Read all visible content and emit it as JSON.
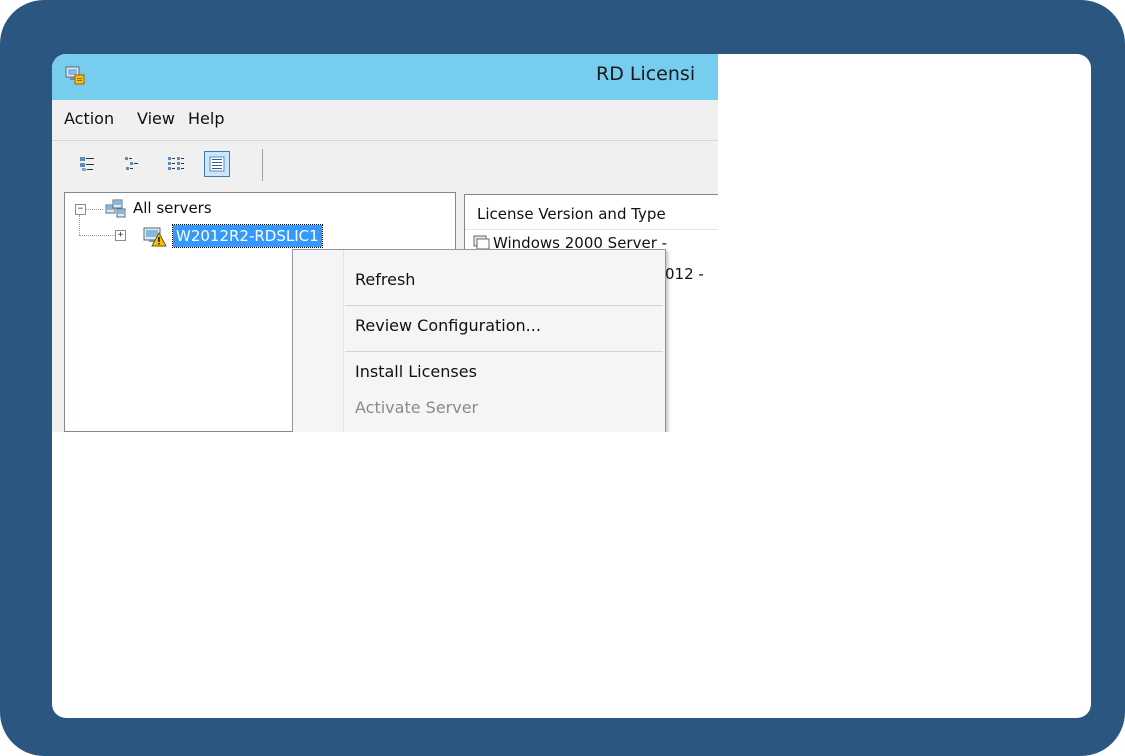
{
  "window": {
    "title": "RD Licensi"
  },
  "menu": [
    "Action",
    "View",
    "Help"
  ],
  "toolbar": {
    "buttons": [
      "small-icons-view",
      "list-view",
      "detail-view",
      "large-detail-view"
    ],
    "active": "large-detail-view"
  },
  "tree": {
    "root_label": "All servers",
    "server_label": "W2012R2-RDSLIC1",
    "server_status": "warning"
  },
  "list": {
    "column_header": "License Version and Type",
    "rows": [
      "Windows 2000 Server -",
      "012 -"
    ]
  },
  "context_menu": {
    "items": [
      {
        "label": "Refresh",
        "enabled": true
      },
      {
        "label": "Review Configuration...",
        "enabled": true
      },
      {
        "label": "Install Licenses",
        "enabled": true
      },
      {
        "label": "Activate Server",
        "enabled": false
      }
    ]
  },
  "colors": {
    "frame": "#2b5680",
    "titlebar": "#76cdee",
    "selection": "#3399ff",
    "warning": "#f4c20d"
  }
}
